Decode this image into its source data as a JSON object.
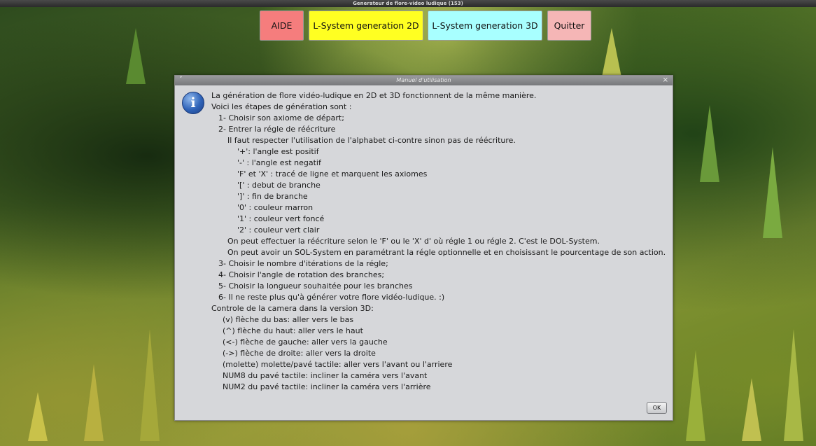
{
  "window": {
    "title": "Generateur de flore-video ludique (153)"
  },
  "toolbar": {
    "buttons": [
      {
        "label": "AIDE",
        "color": "#f57d7d"
      },
      {
        "label": "L-System generation 2D",
        "color": "#ffff22"
      },
      {
        "label": "L-System generation 3D",
        "color": "#a8ffff"
      },
      {
        "label": "Quitter",
        "color": "#f5b6b6"
      }
    ]
  },
  "dialog": {
    "title": "Manuel d'utilisation",
    "menu_glyph": "˅",
    "close_glyph": "×",
    "icon_glyph": "i",
    "ok_label": "OK",
    "lines": [
      "La génération de flore vidéo-ludique en 2D et 3D fonctionnent de la même manière.",
      "Voici les étapes de génération sont :",
      "1- Choisir son axiome de départ;",
      "2- Entrer la régle de réécriture",
      "Il faut respecter l'utilisation de l'alphabet ci-contre sinon pas de réécriture.",
      "'+': l'angle est positif",
      "'-' : l'angle est negatif",
      "'F' et 'X' : tracé de ligne et marquent les axiomes",
      "'[' : debut de branche",
      "']' : fin de branche",
      "'0' : couleur marron",
      "'1' : couleur vert foncé",
      "'2' : couleur vert clair",
      "On peut effectuer la réécriture selon le 'F' ou le 'X' d' où régle 1 ou régle 2. C'est le DOL-System.",
      "On peut avoir un SOL-System en paramétrant la régle optionnelle et en choisissant le pourcentage de son action.",
      "3- Choisir le nombre d'itérations de la régle;",
      "4- Choisir l'angle de rotation des branches;",
      "5- Choisir la longueur souhaitée pour les branches",
      "6- Il ne reste plus qu'à générer votre flore vidéo-ludique. :)",
      "Controle de la camera dans la version 3D:",
      "(v) flèche du bas: aller vers le bas",
      "(^) flèche du haut: aller vers le haut",
      "(<-) flèche de gauche: aller vers la gauche",
      "(->) flèche de droite: aller vers la droite",
      "(molette) molette/pavé tactile: aller vers l'avant ou l'arriere",
      "NUM8 du pavé tactile: incliner la caméra vers l'avant",
      "NUM2 du pavé tactile: incliner la caméra vers l'arrière"
    ]
  }
}
